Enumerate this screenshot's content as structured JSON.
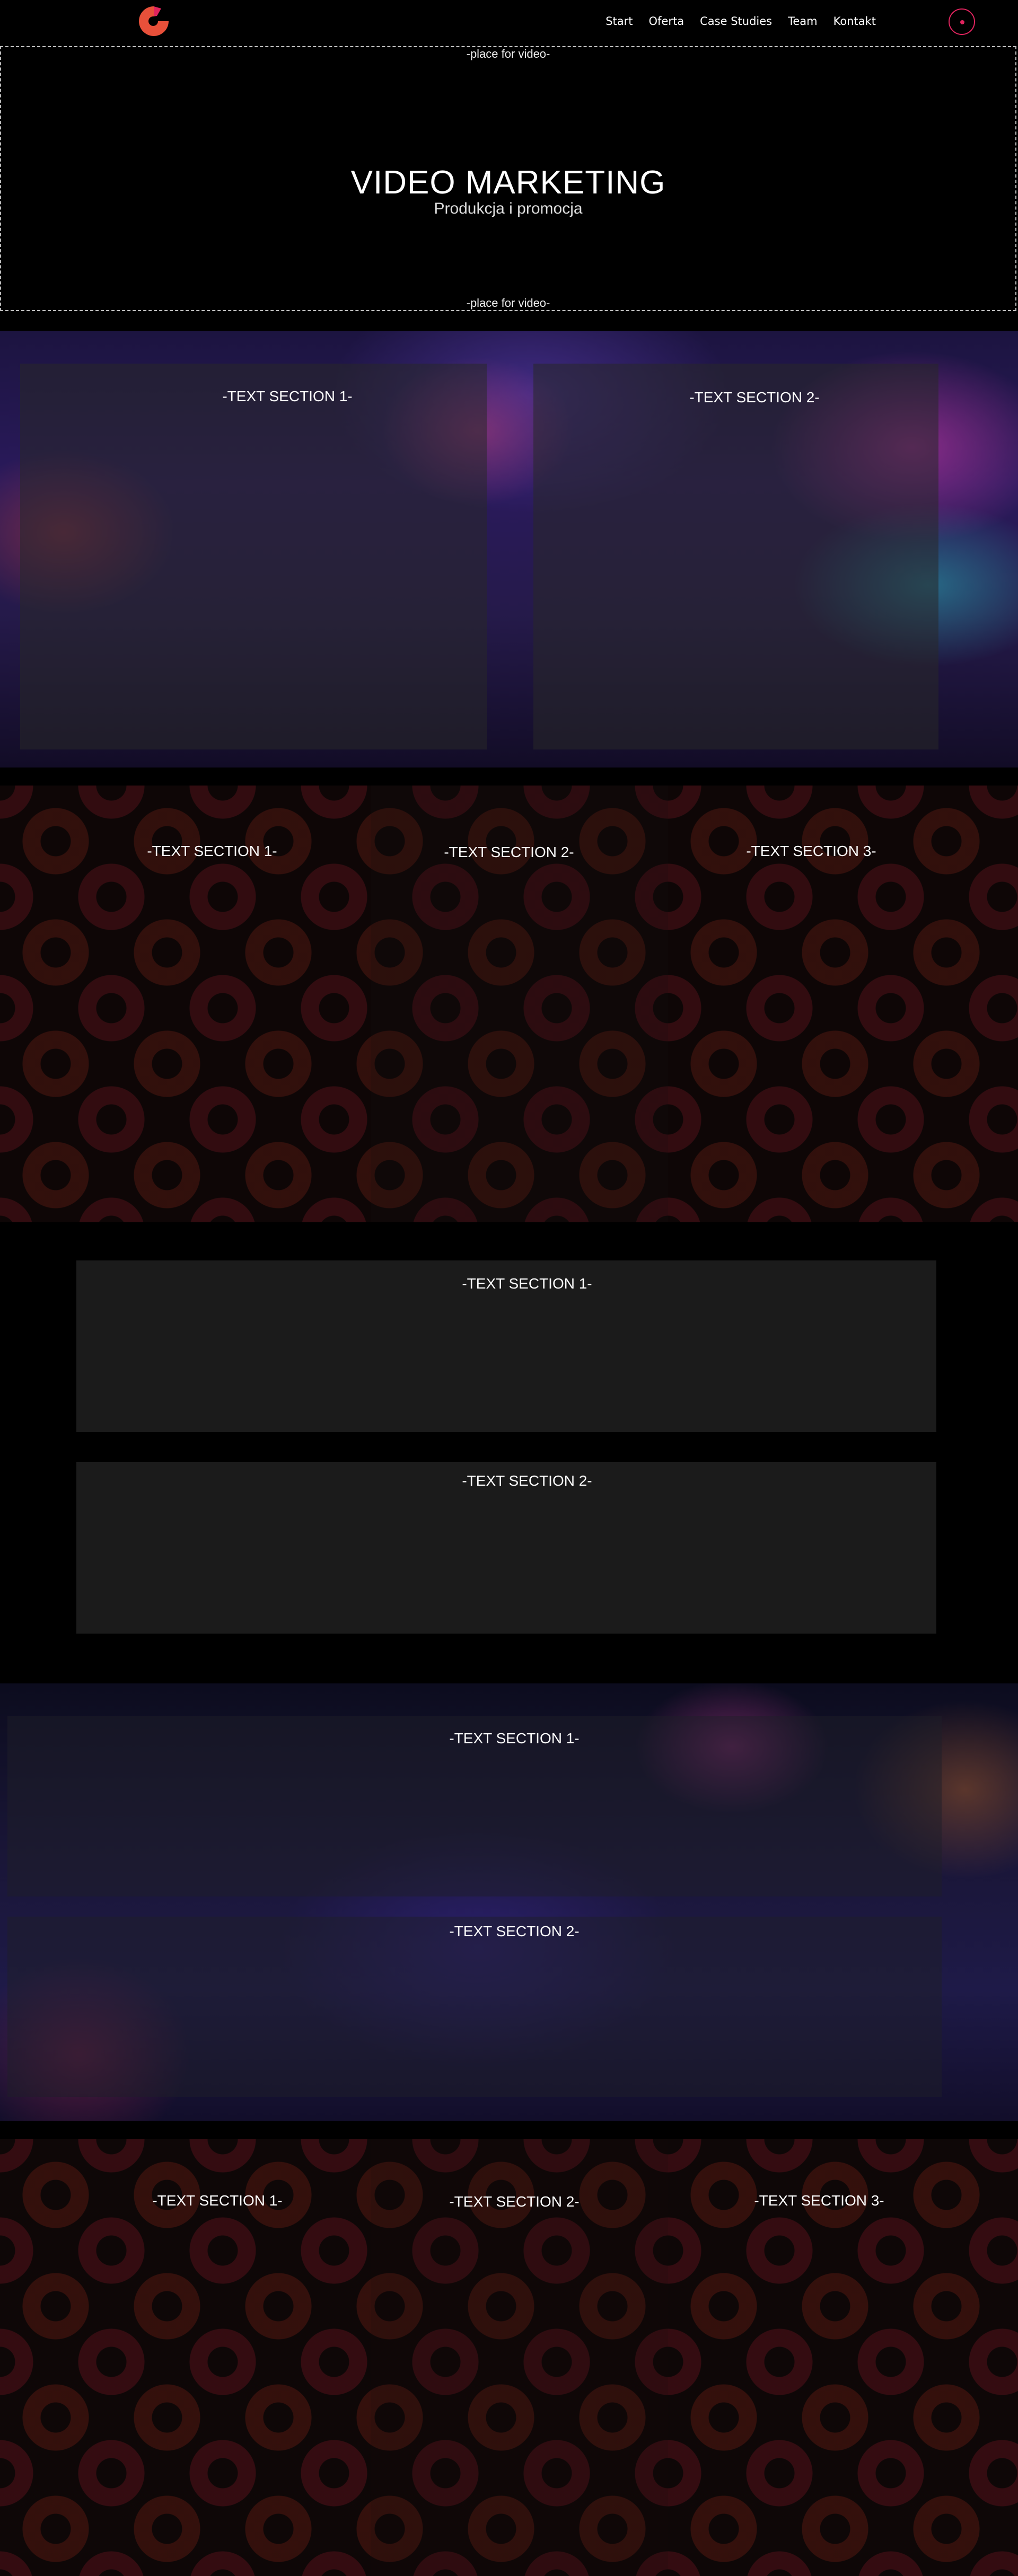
{
  "header": {
    "nav": [
      "Start",
      "Oferta",
      "Case Studies",
      "Team",
      "Kontakt"
    ],
    "logo_icon": "g-logo-icon",
    "menu_icon": "menu-dot-icon",
    "accent_color": "#e0245e"
  },
  "hero": {
    "placeholder_top": "-place for video-",
    "title": "VIDEO MARKETING",
    "subtitle": "Produkcja i promocja",
    "placeholder_bottom": "-place for video-"
  },
  "section_studio": {
    "text1": "-TEXT SECTION 1-",
    "text2": "-TEXT SECTION 2-"
  },
  "section_pattern_a": {
    "text1": "-TEXT SECTION 1-",
    "text2": "-TEXT SECTION 2-",
    "text3": "-TEXT SECTION 3-"
  },
  "section_boxes": {
    "text1": "-TEXT SECTION 1-",
    "text2": "-TEXT SECTION 2-"
  },
  "section_studio2": {
    "text1": "-TEXT SECTION 1-",
    "text2": "-TEXT SECTION 2-"
  },
  "section_pattern_b": {
    "text1": "-TEXT SECTION 1-",
    "text2": "-TEXT SECTION 2-",
    "text3": "-TEXT SECTION 3-"
  }
}
